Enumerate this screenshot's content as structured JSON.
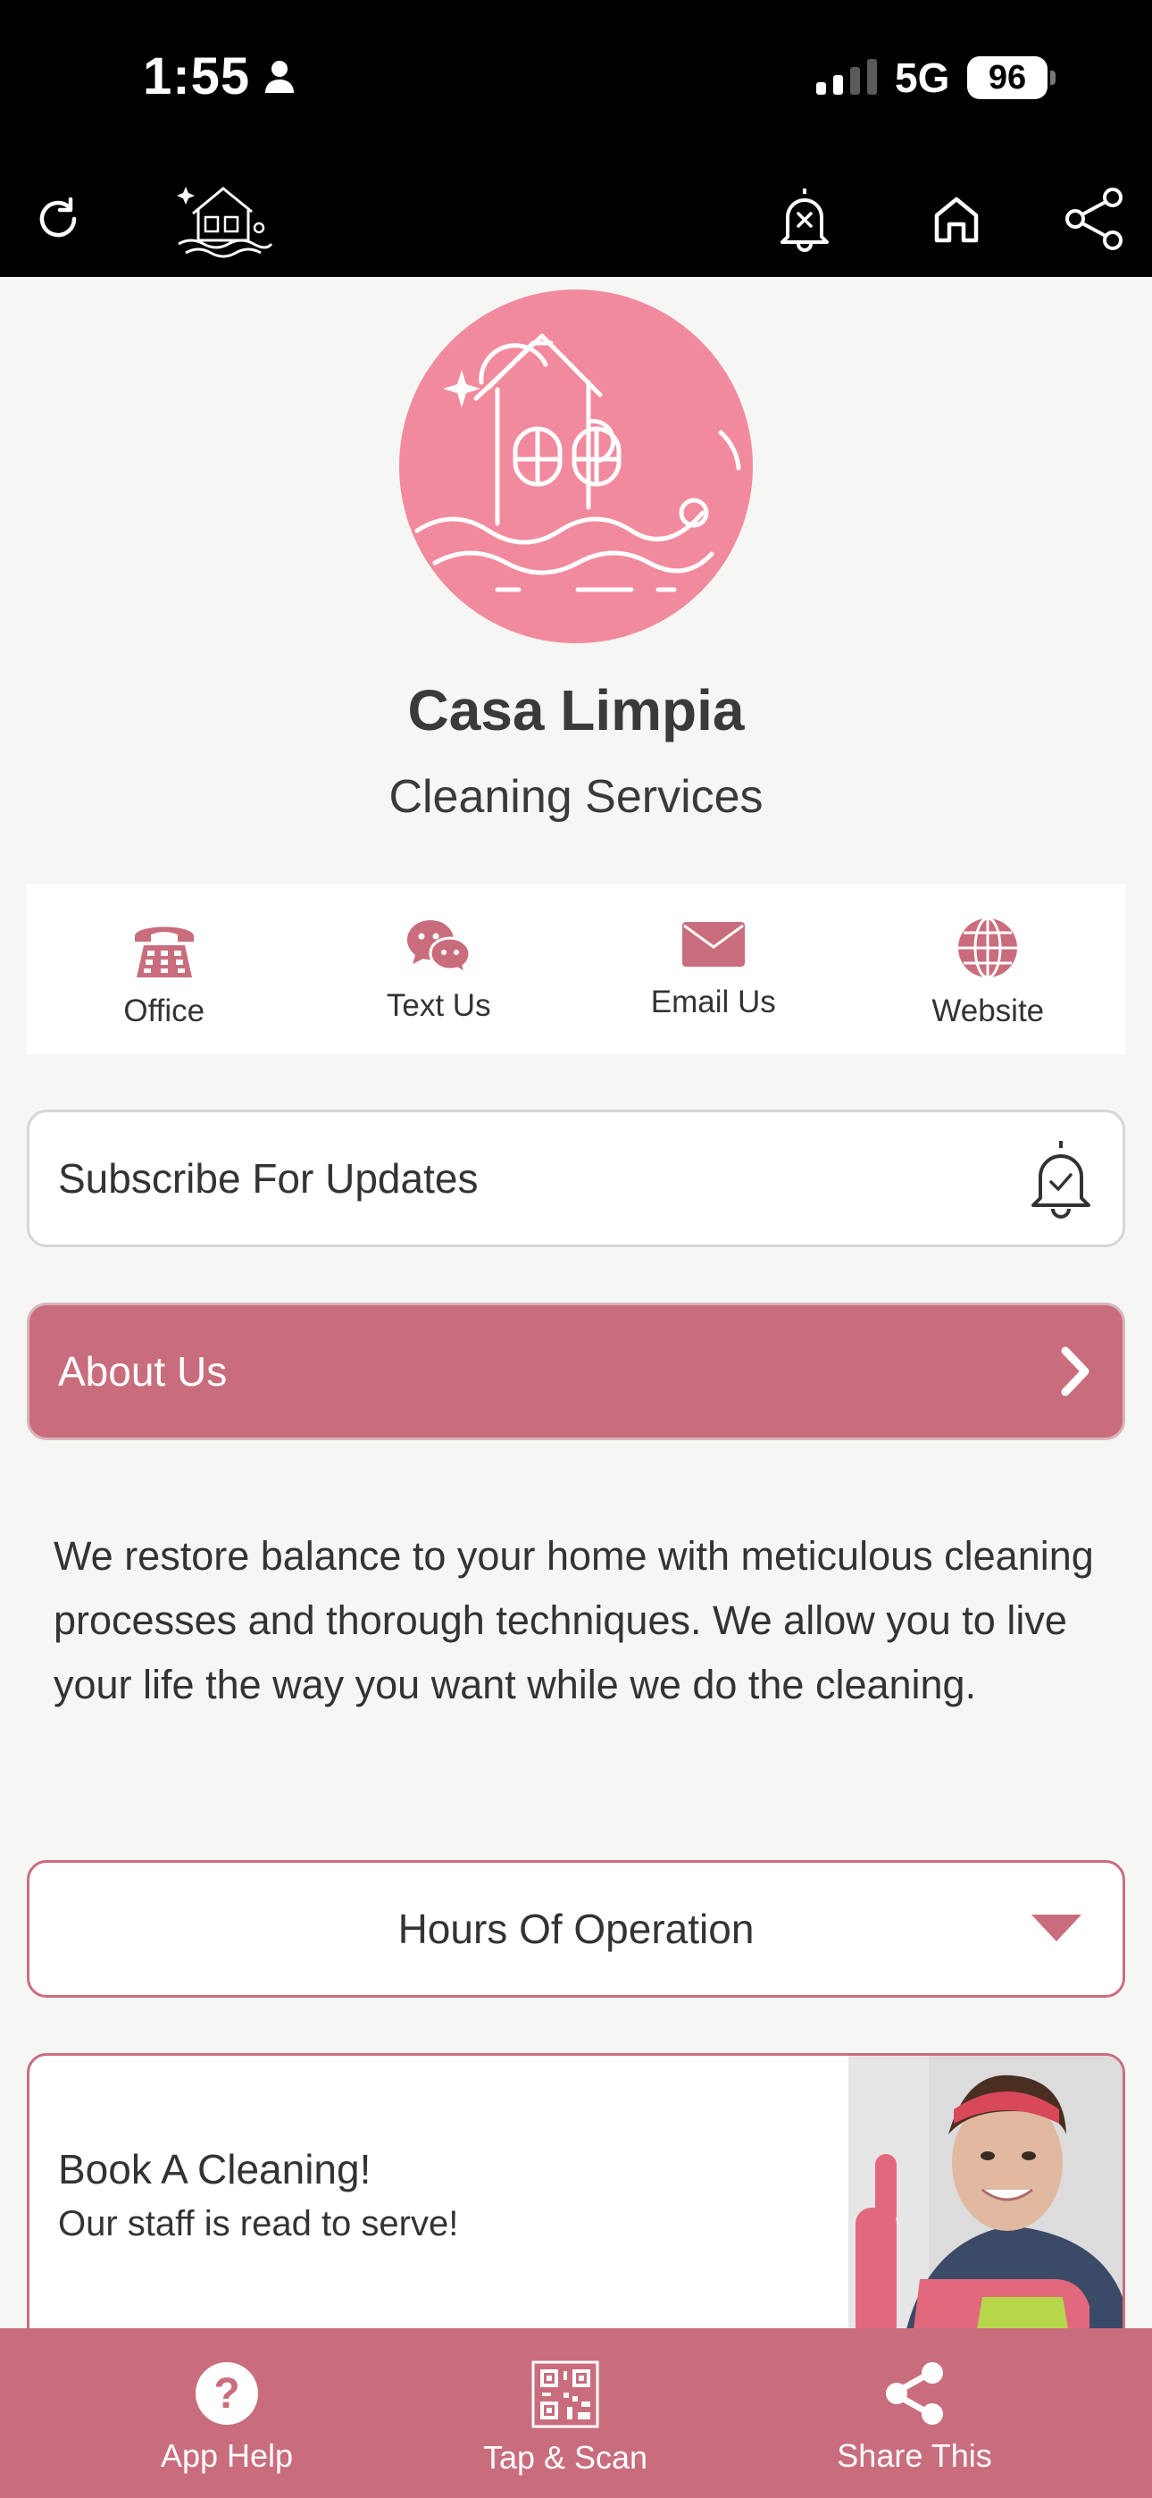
{
  "status_bar": {
    "time": "1:55",
    "network": "5G",
    "battery": "96"
  },
  "header": {
    "icons": [
      "refresh-icon",
      "house-logo-icon",
      "bell-muted-icon",
      "home-icon",
      "share-icon"
    ]
  },
  "business": {
    "name": "Casa Limpia",
    "subtitle": "Cleaning Services"
  },
  "quick_actions": [
    {
      "label": "Office",
      "icon": "phone-icon"
    },
    {
      "label": "Text Us",
      "icon": "chat-icon"
    },
    {
      "label": "Email Us",
      "icon": "envelope-icon"
    },
    {
      "label": "Website",
      "icon": "globe-icon"
    }
  ],
  "subscribe": {
    "label": "Subscribe For Updates"
  },
  "about": {
    "label": "About Us",
    "text": "We restore balance to your home with meticulous cleaning processes and thorough techniques. We allow you to live your life the way you want while we do the cleaning."
  },
  "hours": {
    "label": "Hours Of Operation"
  },
  "book": {
    "title": "Book A Cleaning!",
    "subtitle": "Our staff is read to serve!"
  },
  "tabbar": [
    {
      "label": "App Help",
      "icon": "help-icon"
    },
    {
      "label": "Tap & Scan",
      "icon": "qr-code-icon"
    },
    {
      "label": "Share This",
      "icon": "share-icon"
    }
  ],
  "colors": {
    "accent": "#c96d7d",
    "logo_bg": "#f28a9d",
    "background": "#f6f6f4",
    "header": "#000000"
  }
}
